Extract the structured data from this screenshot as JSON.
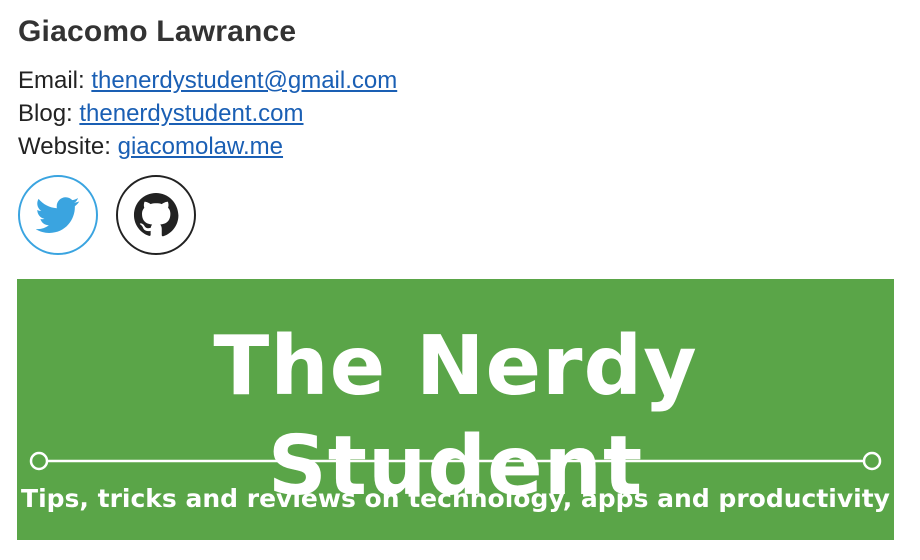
{
  "signature": {
    "name": "Giacomo Lawrance",
    "contacts": [
      {
        "label": "Email:",
        "link_text": "thenerdystudent@gmail.com"
      },
      {
        "label": "Blog:",
        "link_text": "thenerdystudent.com"
      },
      {
        "label": "Website:",
        "link_text": "giacomolaw.me"
      }
    ],
    "social": [
      {
        "icon": "twitter-icon",
        "color": "#3aa4e0"
      },
      {
        "icon": "github-icon",
        "color": "#222222"
      }
    ]
  },
  "banner": {
    "title": "The Nerdy Student",
    "tagline": "Tips, tricks and reviews on technology, apps and productivity",
    "background_color": "#5aa548",
    "text_color": "#ffffff"
  },
  "colors": {
    "link": "#1a5fb4",
    "name": "#333333"
  }
}
